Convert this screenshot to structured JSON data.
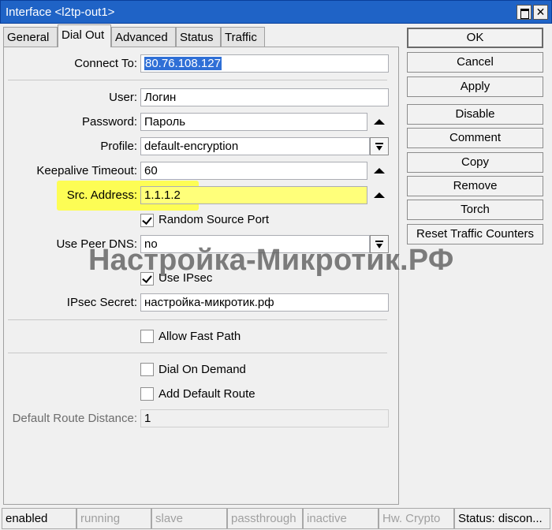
{
  "window": {
    "title": "Interface <l2tp-out1>"
  },
  "tabs": [
    "General",
    "Dial Out",
    "Advanced",
    "Status",
    "Traffic"
  ],
  "form": {
    "connect_to": {
      "label": "Connect To:",
      "value": "80.76.108.127"
    },
    "user": {
      "label": "User:",
      "value": "Логин"
    },
    "password": {
      "label": "Password:",
      "value": "Пароль"
    },
    "profile": {
      "label": "Profile:",
      "value": "default-encryption"
    },
    "keepalive": {
      "label": "Keepalive Timeout:",
      "value": "60"
    },
    "src_address": {
      "label": "Src. Address:",
      "value": "1.1.1.2"
    },
    "random_source_port": {
      "label": "Random Source Port",
      "checked": true
    },
    "use_peer_dns": {
      "label": "Use Peer DNS:",
      "value": "no"
    },
    "use_ipsec": {
      "label": "Use IPsec",
      "checked": true
    },
    "ipsec_secret": {
      "label": "IPsec Secret:",
      "value": "настройка-микротик.рф"
    },
    "allow_fast_path": {
      "label": "Allow Fast Path",
      "checked": false
    },
    "dial_on_demand": {
      "label": "Dial On Demand",
      "checked": false
    },
    "add_default_route": {
      "label": "Add Default Route",
      "checked": false
    },
    "default_route_distance": {
      "label": "Default Route Distance:",
      "value": "1"
    }
  },
  "watermark": "Настройка-Микротик.РФ",
  "buttons": [
    "OK",
    "Cancel",
    "Apply",
    "Disable",
    "Comment",
    "Copy",
    "Remove",
    "Torch",
    "Reset Traffic Counters"
  ],
  "status": {
    "enabled": "enabled",
    "running": "running",
    "slave": "slave",
    "passthrough": "passthrough",
    "inactive": "inactive",
    "hw_crypto": "Hw. Crypto",
    "status": "Status: discon..."
  },
  "colors": {
    "titlebar": "#1f63c6",
    "highlight": "#ffff3a",
    "selection": "#2f6fd6"
  }
}
